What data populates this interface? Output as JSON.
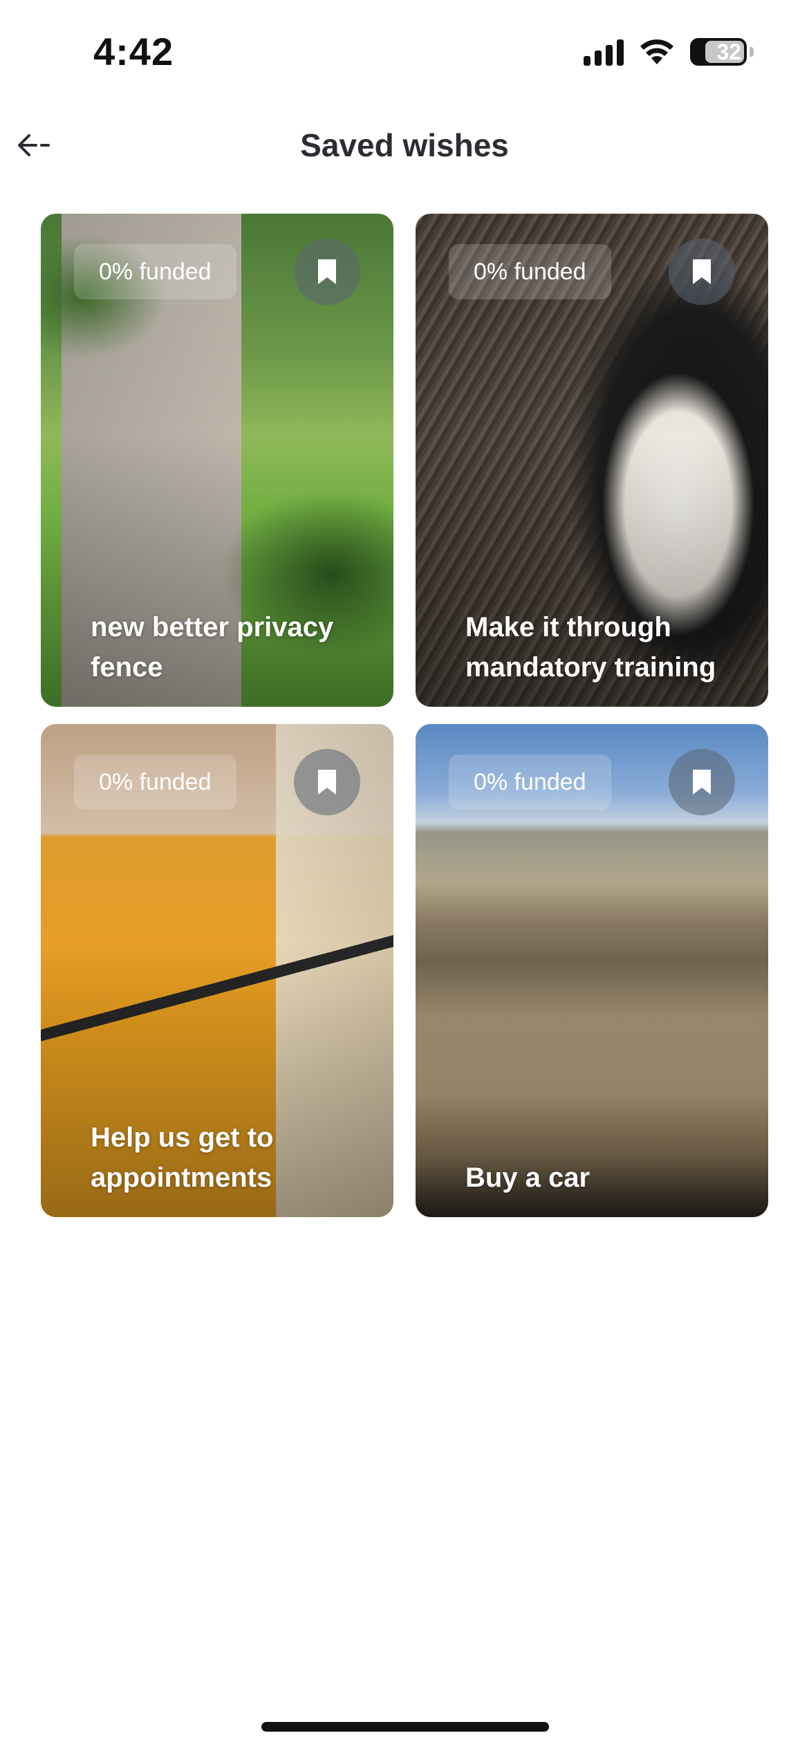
{
  "status_bar": {
    "time": "4:42",
    "battery_level": "32",
    "icons": [
      "cellular-signal-icon",
      "wifi-icon",
      "battery-icon"
    ]
  },
  "header": {
    "back_icon": "arrow-left-icon",
    "title": "Saved wishes"
  },
  "cards": [
    {
      "funded": "0% funded",
      "title": "new better privacy fence",
      "saved_icon": "bookmark-icon",
      "saved": true,
      "funded_fraction": 0.0
    },
    {
      "funded": "0% funded",
      "title": "Make it through mandatory training",
      "saved_icon": "bookmark-icon",
      "saved": true,
      "funded_fraction": 0.0
    },
    {
      "funded": "0% funded",
      "title": "Help us get to appointments",
      "saved_icon": "bookmark-icon",
      "saved": true,
      "funded_fraction": 0.0
    },
    {
      "funded": "0% funded",
      "title": "Buy a car",
      "saved_icon": "bookmark-icon",
      "saved": true,
      "funded_fraction": 0.0
    }
  ],
  "colors": {
    "title_text": "#2b2d33",
    "background": "#ffffff",
    "badge_bg": "rgba(255,255,255,0.18)",
    "bookmark_button_bg": "rgba(90,100,115,0.55)"
  }
}
